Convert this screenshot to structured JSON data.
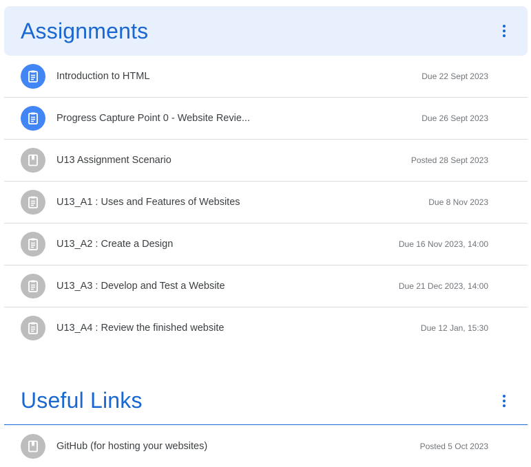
{
  "assignments": {
    "title": "Assignments",
    "items": [
      {
        "title": "Introduction to HTML",
        "date": "Due 22 Sept 2023",
        "icon": "assignment-icon",
        "active": true
      },
      {
        "title": "Progress Capture Point 0 - Website Revie...",
        "date": "Due 26 Sept 2023",
        "icon": "assignment-icon",
        "active": true
      },
      {
        "title": "U13 Assignment Scenario",
        "date": "Posted 28 Sept 2023",
        "icon": "material-icon",
        "active": false
      },
      {
        "title": "U13_A1 : Uses and Features of Websites",
        "date": "Due 8 Nov 2023",
        "icon": "assignment-icon",
        "active": false
      },
      {
        "title": "U13_A2 : Create a Design",
        "date": "Due 16 Nov 2023, 14:00",
        "icon": "assignment-icon",
        "active": false
      },
      {
        "title": "U13_A3 : Develop and Test a Website",
        "date": "Due 21 Dec 2023, 14:00",
        "icon": "assignment-icon",
        "active": false
      },
      {
        "title": "U13_A4 : Review the finished website",
        "date": "Due 12 Jan, 15:30",
        "icon": "assignment-icon",
        "active": false
      }
    ]
  },
  "useful_links": {
    "title": "Useful Links",
    "items": [
      {
        "title": "GitHub (for hosting your websites)",
        "date": "Posted 5 Oct 2023",
        "icon": "material-icon",
        "active": false
      }
    ]
  },
  "colors": {
    "accent": "#1967d2",
    "header_bg": "#e8f0fe",
    "icon_active": "#4285f4",
    "icon_inactive": "#bdbdbd"
  }
}
